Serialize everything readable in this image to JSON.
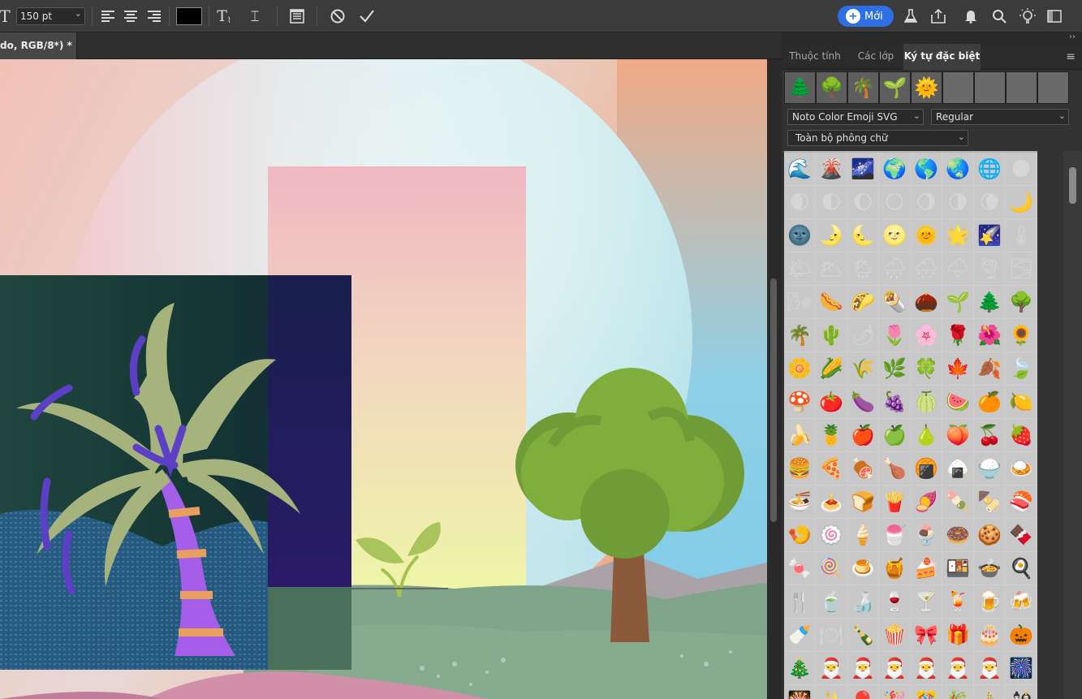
{
  "toolbar": {
    "font_size": "150 pt",
    "new_button_label": "Mới",
    "text_color": "#000000",
    "accent": "#2f6fe6"
  },
  "document": {
    "tab_title": "do, RGB/8*) *"
  },
  "panel": {
    "tabs": [
      "Thuộc tính",
      "Các lớp",
      "Ký tự đặc biệt"
    ],
    "active_tab": "Ký tự đặc biệt",
    "recent_glyphs": [
      "🌲",
      "🌳",
      "🌴",
      "🌱",
      "🌞",
      "",
      "",
      "",
      ""
    ],
    "font_family": "Noto Color Emoji SVG",
    "font_style": "Regular",
    "glyph_filter": "Toàn bộ phông chữ",
    "glyph_rows": [
      [
        "🌊",
        "🌋",
        "🌌",
        "🌍",
        "🌎",
        "🌏",
        "🌐",
        "🌑"
      ],
      [
        "🌒",
        "🌓",
        "🌔",
        "🌕",
        "🌖",
        "🌗",
        "🌘",
        "🌙"
      ],
      [
        "🌚",
        "🌛",
        "🌜",
        "🌝",
        "🌞",
        "🌟",
        "🌠",
        "🌡"
      ],
      [
        "🌤",
        "🌥",
        "🌦",
        "🌧",
        "🌨",
        "🌩",
        "🌪",
        "🌫"
      ],
      [
        "🌬",
        "🌭",
        "🌮",
        "🌯",
        "🌰",
        "🌱",
        "🌲",
        "🌳"
      ],
      [
        "🌴",
        "🌵",
        "🌶",
        "🌷",
        "🌸",
        "🌹",
        "🌺",
        "🌻"
      ],
      [
        "🌼",
        "🌽",
        "🌾",
        "🌿",
        "🍀",
        "🍁",
        "🍂",
        "🍃"
      ],
      [
        "🍄",
        "🍅",
        "🍆",
        "🍇",
        "🍈",
        "🍉",
        "🍊",
        "🍋"
      ],
      [
        "🍌",
        "🍍",
        "🍎",
        "🍏",
        "🍐",
        "🍑",
        "🍒",
        "🍓"
      ],
      [
        "🍔",
        "🍕",
        "🍖",
        "🍗",
        "🍘",
        "🍙",
        "🍚",
        "🍛"
      ],
      [
        "🍜",
        "🍝",
        "🍞",
        "🍟",
        "🍠",
        "🍡",
        "🍢",
        "🍣"
      ],
      [
        "🍤",
        "🍥",
        "🍦",
        "🍧",
        "🍨",
        "🍩",
        "🍪",
        "🍫"
      ],
      [
        "🍬",
        "🍭",
        "🍮",
        "🍯",
        "🍰",
        "🍱",
        "🍲",
        "🍳"
      ],
      [
        "🍴",
        "🍵",
        "🍶",
        "🍷",
        "🍸",
        "🍹",
        "🍺",
        "🍻"
      ],
      [
        "🍼",
        "🍽",
        "🍾",
        "🍿",
        "🎀",
        "🎁",
        "🎂",
        "🎃"
      ],
      [
        "🎄",
        "🎅",
        "🎅",
        "🎅",
        "🎅",
        "🎅",
        "🎅",
        "🎆"
      ],
      [
        "🎇",
        "✨",
        "🎈",
        "🎉",
        "🎊",
        "🎋",
        "🎍",
        "🎎"
      ]
    ]
  },
  "icons": {
    "text_tool": "text-tool-icon",
    "align_left": "align-left-icon",
    "align_center": "align-center-icon",
    "align_right": "align-right-icon",
    "warp_text": "warp-text-icon",
    "text_on_path": "text-on-path-icon",
    "character_panel": "character-panel-icon",
    "cancel": "cancel-icon",
    "commit": "commit-icon",
    "lab": "flask-icon",
    "share": "share-icon",
    "notifications": "bell-icon",
    "search": "search-icon",
    "tips": "lightbulb-icon",
    "workspace": "workspace-icon"
  }
}
